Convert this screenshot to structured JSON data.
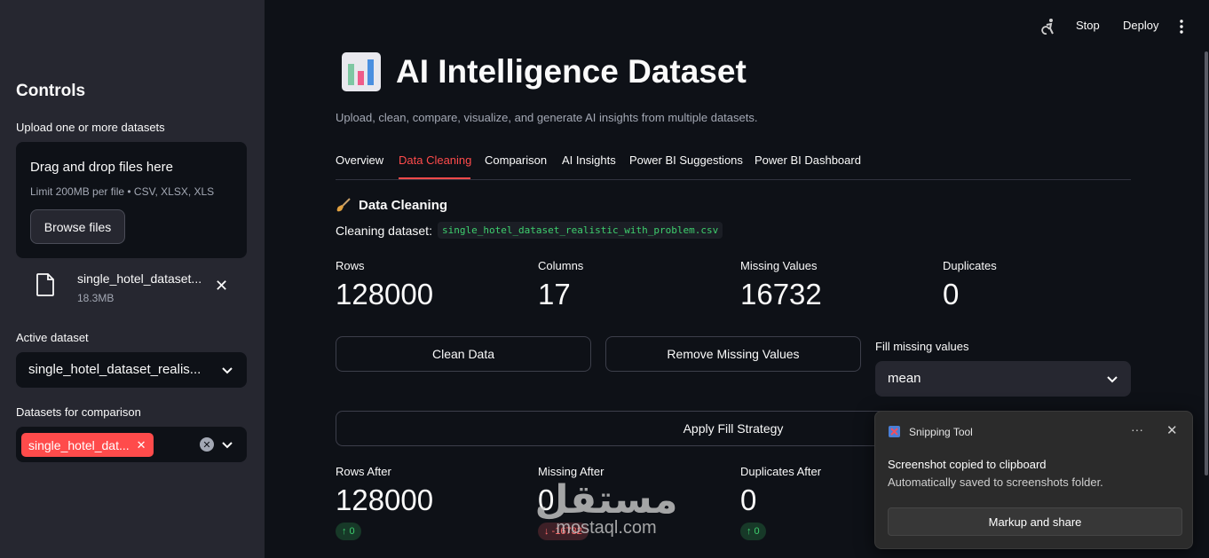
{
  "sidebar": {
    "title": "Controls",
    "upload_label": "Upload one or more datasets",
    "dropzone_title": "Drag and drop files here",
    "dropzone_limit": "Limit 200MB per file • CSV, XLSX, XLS",
    "browse_label": "Browse files",
    "file_name": "single_hotel_dataset...",
    "file_size": "18.3MB",
    "active_label": "Active dataset",
    "active_value": "single_hotel_dataset_realis...",
    "comparison_label": "Datasets for comparison",
    "comparison_tag": "single_hotel_dat..."
  },
  "topbar": {
    "stop": "Stop",
    "deploy": "Deploy"
  },
  "main": {
    "title": "AI Intelligence Dataset",
    "subtitle": "Upload, clean, compare, visualize, and generate AI insights from multiple datasets.",
    "tabs": [
      "Overview",
      "Data Cleaning",
      "Comparison",
      "AI Insights",
      "Power BI Suggestions",
      "Power BI Dashboard"
    ],
    "section_title": "Data Cleaning",
    "cleaning_label": "Cleaning dataset:",
    "cleaning_file": "single_hotel_dataset_realistic_with_problem.csv",
    "metrics": [
      {
        "label": "Rows",
        "value": "128000"
      },
      {
        "label": "Columns",
        "value": "17"
      },
      {
        "label": "Missing Values",
        "value": "16732"
      },
      {
        "label": "Duplicates",
        "value": "0"
      }
    ],
    "buttons": {
      "clean": "Clean Data",
      "remove": "Remove Missing Values",
      "apply": "Apply Fill Strategy"
    },
    "fill_label": "Fill missing values",
    "fill_value": "mean",
    "after_metrics": [
      {
        "label": "Rows After",
        "value": "128000",
        "delta": "↑ 0"
      },
      {
        "label": "Missing After",
        "value": "0",
        "delta": "↓ -16732"
      },
      {
        "label": "Duplicates After",
        "value": "0",
        "delta": "↑ 0"
      }
    ]
  },
  "notification": {
    "app": "Snipping Tool",
    "title": "Screenshot copied to clipboard",
    "body": "Automatically saved to screenshots folder.",
    "button": "Markup and share"
  },
  "watermark": {
    "arabic": "مستقل",
    "latin": "mostaql.com"
  }
}
